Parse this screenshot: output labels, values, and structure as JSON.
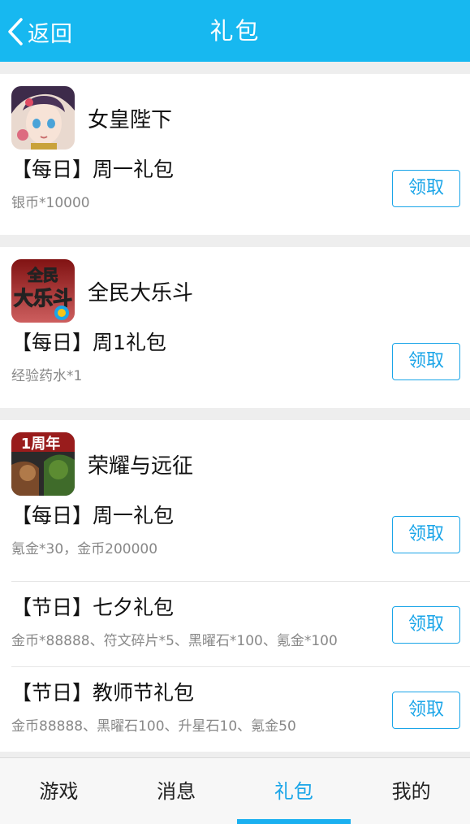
{
  "header": {
    "back_label": "返回",
    "title": "礼包"
  },
  "cards": [
    {
      "game_name": "女皇陛下",
      "icon": "empress-game-icon",
      "gifts": [
        {
          "title": "【每日】周一礼包",
          "desc": "银币*10000",
          "button": "领取"
        }
      ]
    },
    {
      "game_name": "全民大乐斗",
      "icon": "daledou-game-icon",
      "icon_text": [
        "全民",
        "大乐斗"
      ],
      "gifts": [
        {
          "title": "【每日】周1礼包",
          "desc": "经验药水*1",
          "button": "领取"
        }
      ]
    },
    {
      "game_name": "荣耀与远征",
      "icon": "glory-game-icon",
      "icon_text": "1周年",
      "gifts": [
        {
          "title": "【每日】周一礼包",
          "desc": "氪金*30，金币200000",
          "button": "领取"
        },
        {
          "title": "【节日】七夕礼包",
          "desc": "金币*88888、符文碎片*5、黑曜石*100、氪金*100",
          "button": "领取"
        },
        {
          "title": "【节日】教师节礼包",
          "desc": "金币88888、黑曜石100、升星石10、氪金50",
          "button": "领取"
        }
      ]
    }
  ],
  "tabs": [
    {
      "label": "游戏",
      "active": false
    },
    {
      "label": "消息",
      "active": false
    },
    {
      "label": "礼包",
      "active": true
    },
    {
      "label": "我的",
      "active": false
    }
  ],
  "colors": {
    "header": "#17b8f0",
    "accent": "#1aa5e8",
    "background": "#eeeeee"
  }
}
